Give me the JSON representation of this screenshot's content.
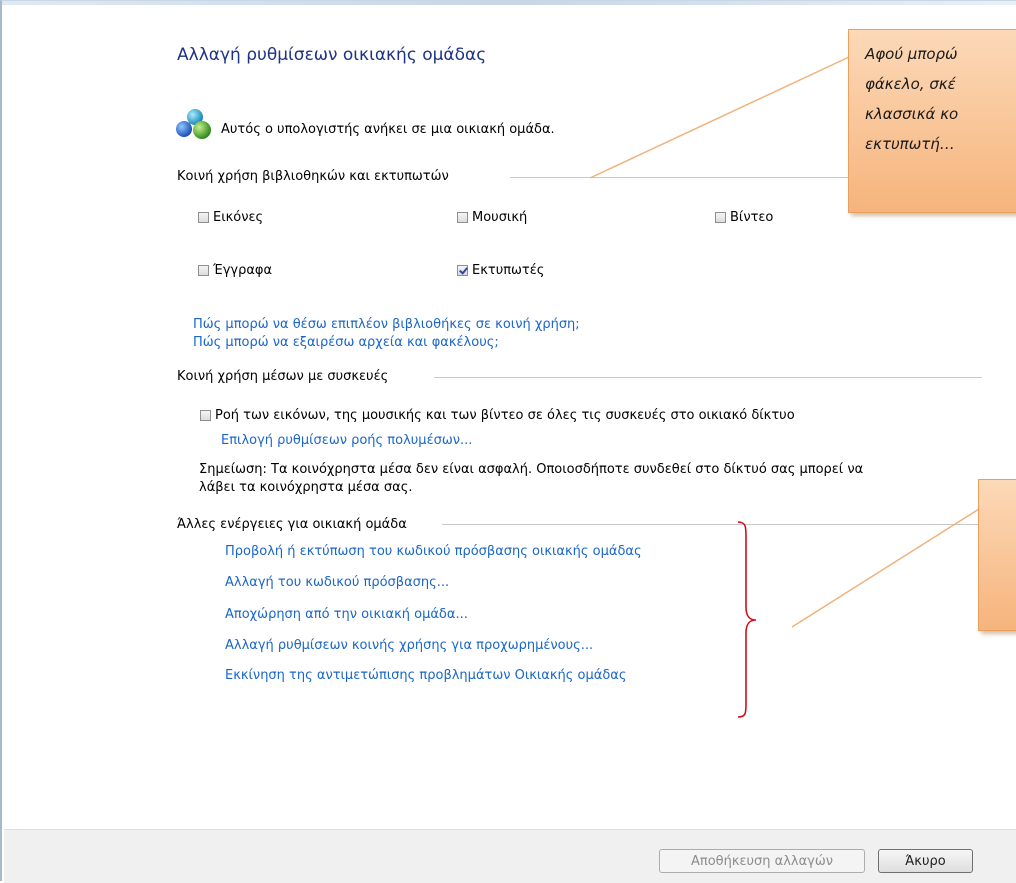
{
  "page": {
    "title": "Αλλαγή ρυθμίσεων οικιακής ομάδας",
    "membership_text": "Αυτός ο υπολογιστής ανήκει σε μια οικιακή ομάδα.",
    "homegroup_icon": "homegroup-icon"
  },
  "libraries": {
    "heading": "Κοινή χρήση βιβλιοθηκών και εκτυπωτών",
    "items": [
      {
        "label": "Εικόνες",
        "checked": false
      },
      {
        "label": "Μουσική",
        "checked": false
      },
      {
        "label": "Βίντεο",
        "checked": false
      },
      {
        "label": "Έγγραφα",
        "checked": false
      },
      {
        "label": "Εκτυπωτές",
        "checked": true
      }
    ],
    "link_more": "Πώς μπορώ να θέσω επιπλέον βιβλιοθήκες σε κοινή χρήση;",
    "link_exclude": "Πώς μπορώ να εξαιρέσω αρχεία και φακέλους;"
  },
  "media": {
    "heading": "Κοινή χρήση μέσων με συσκευές",
    "stream_label": "Ροή των εικόνων, της μουσικής και των βίντεο σε όλες τις συσκευές στο οικιακό δίκτυο",
    "stream_checked": false,
    "stream_link": "Επιλογή ρυθμίσεων ροής πολυμέσων...",
    "note_line1": "Σημείωση: Τα κοινόχρηστα μέσα δεν είναι ασφαλή. Οποιοσδήποτε συνδεθεί στο δίκτυό σας μπορεί να",
    "note_line2": "λάβει τα κοινόχρηστα μέσα σας."
  },
  "other": {
    "heading": "Άλλες ενέργειες για οικιακή ομάδα",
    "actions": [
      "Προβολή ή εκτύπωση του κωδικού πρόσβασης οικιακής ομάδας",
      "Αλλαγή του κωδικού πρόσβασης...",
      "Αποχώρηση από την οικιακή ομάδα...",
      "Αλλαγή ρυθμίσεων κοινής χρήσης για προχωρημένους...",
      "Εκκίνηση της αντιμετώπισης προβλημάτων Οικιακής ομάδας"
    ]
  },
  "footer": {
    "save_label": "Αποθήκευση αλλαγών",
    "cancel_label": "Άκυρο"
  },
  "callouts": {
    "top_lines": [
      "Αφού μπορώ",
      "φάκελο, σκέ",
      "κλασσικά κο",
      "εκτυπωτή…"
    ],
    "bottom_lines": []
  },
  "colors": {
    "link": "#1a66c9",
    "title": "#1e3287",
    "callout": "#f6b47c",
    "brace": "#d0101a"
  }
}
